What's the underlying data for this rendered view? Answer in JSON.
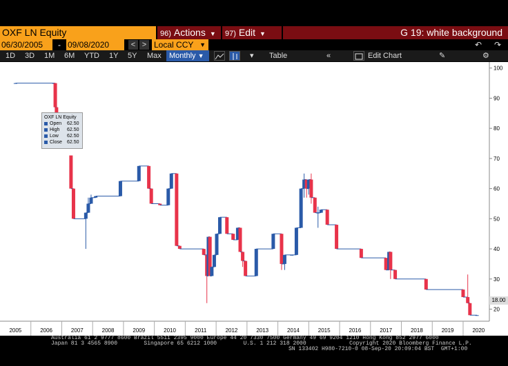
{
  "header": {
    "ticker": "OXF LN Equity",
    "actions_num": "96)",
    "actions_label": "Actions",
    "edit_num": "97)",
    "edit_label": "Edit",
    "graph_title": "G 19: white background"
  },
  "date_bar": {
    "start_date": "06/30/2005",
    "end_date": "09/08/2020",
    "currency": "Local CCY"
  },
  "toolbar": {
    "periods": [
      "1D",
      "3D",
      "1M",
      "6M",
      "YTD",
      "1Y",
      "5Y",
      "Max"
    ],
    "frequency": "Monthly",
    "table_label": "Table",
    "edit_chart_label": "Edit Chart"
  },
  "tooltip": {
    "title": "OXF LN Equity",
    "rows": [
      {
        "label": "Open",
        "value": "62.50"
      },
      {
        "label": "High",
        "value": "62.50"
      },
      {
        "label": "Low",
        "value": "62.50"
      },
      {
        "label": "Close",
        "value": "62.50"
      }
    ]
  },
  "last_price_badge": "18.00",
  "footer": {
    "line1": "Australia 61 2 9777 8600 Brazil 5511 2395 9000 Europe 44 20 7330 7500 Germany 49 69 9204 1210 Hong Kong 852 2977 6000",
    "line2": "Japan 81 3 4565 8900        Singapore 65 6212 1000        U.S. 1 212 318 2000             Copyright 2020 Bloomberg Finance L.P.",
    "line3": "SN 133402 H980-7210-0 08-Sep-20 20:09:04 BST  GMT+1:00"
  },
  "colors": {
    "up": "#2a5aa8",
    "down": "#e8334a",
    "accent": "#f9a11b",
    "menu": "#7a0d12"
  },
  "chart_data": {
    "type": "candlestick",
    "title": "",
    "xlabel": "",
    "ylabel": "",
    "ylim": [
      16,
      102
    ],
    "xlim": [
      2005.0,
      2020.85
    ],
    "yticks": [
      20,
      30,
      40,
      50,
      60,
      70,
      80,
      90,
      100
    ],
    "xticks": [
      "2005",
      "2006",
      "2007",
      "2008",
      "2009",
      "2010",
      "2011",
      "2012",
      "2013",
      "2014",
      "2015",
      "2016",
      "2017",
      "2018",
      "2019",
      "2020"
    ],
    "grid": false,
    "legend": "none",
    "series": [
      {
        "name": "OXF LN Equity",
        "candles": [
          {
            "x": 2005.5,
            "open": 95,
            "high": 95,
            "low": 95,
            "close": 95
          },
          {
            "x": 2006.75,
            "open": 95,
            "high": 95,
            "low": 95,
            "close": 95
          },
          {
            "x": 2006.79,
            "open": 95,
            "high": 95,
            "low": 86,
            "close": 87
          },
          {
            "x": 2006.83,
            "open": 87,
            "high": 87,
            "low": 80,
            "close": 81
          },
          {
            "x": 2007.3,
            "open": 71,
            "high": 71,
            "low": 60,
            "close": 60
          },
          {
            "x": 2007.38,
            "open": 60,
            "high": 60,
            "low": 50,
            "close": 50
          },
          {
            "x": 2007.78,
            "open": 50,
            "high": 52,
            "low": 40,
            "close": 52
          },
          {
            "x": 2007.86,
            "open": 52,
            "high": 57,
            "low": 52,
            "close": 55
          },
          {
            "x": 2007.95,
            "open": 55,
            "high": 58,
            "low": 55,
            "close": 57
          },
          {
            "x": 2008.1,
            "open": 57,
            "high": 57.5,
            "low": 57,
            "close": 57.5
          },
          {
            "x": 2008.9,
            "open": 57.5,
            "high": 62.5,
            "low": 57.5,
            "close": 62.5
          },
          {
            "x": 2009.5,
            "open": 62.5,
            "high": 67.5,
            "low": 62.5,
            "close": 67.5
          },
          {
            "x": 2009.82,
            "open": 67.5,
            "high": 67.5,
            "low": 60,
            "close": 60
          },
          {
            "x": 2009.9,
            "open": 60,
            "high": 60,
            "low": 55,
            "close": 55
          },
          {
            "x": 2010.18,
            "open": 55,
            "high": 55,
            "low": 54.5,
            "close": 54.5
          },
          {
            "x": 2010.45,
            "open": 54.5,
            "high": 60,
            "low": 54.5,
            "close": 60
          },
          {
            "x": 2010.55,
            "open": 60,
            "high": 65,
            "low": 60,
            "close": 65
          },
          {
            "x": 2010.72,
            "open": 65,
            "high": 65,
            "low": 41,
            "close": 41
          },
          {
            "x": 2010.82,
            "open": 41,
            "high": 41,
            "low": 40,
            "close": 40
          },
          {
            "x": 2011.6,
            "open": 40,
            "high": 40,
            "low": 38,
            "close": 38
          },
          {
            "x": 2011.7,
            "open": 38,
            "high": 38,
            "low": 22,
            "close": 31
          },
          {
            "x": 2011.75,
            "open": 31,
            "high": 44,
            "low": 31,
            "close": 44
          },
          {
            "x": 2011.8,
            "open": 44,
            "high": 44,
            "low": 31,
            "close": 31
          },
          {
            "x": 2011.86,
            "open": 31,
            "high": 34,
            "low": 31,
            "close": 34
          },
          {
            "x": 2011.94,
            "open": 34,
            "high": 38,
            "low": 34,
            "close": 38
          },
          {
            "x": 2012.02,
            "open": 38,
            "high": 45,
            "low": 38,
            "close": 45
          },
          {
            "x": 2012.12,
            "open": 45,
            "high": 50.5,
            "low": 45,
            "close": 50.5
          },
          {
            "x": 2012.35,
            "open": 50.5,
            "high": 50.5,
            "low": 45,
            "close": 45
          },
          {
            "x": 2012.55,
            "open": 45,
            "high": 45,
            "low": 43,
            "close": 43
          },
          {
            "x": 2012.7,
            "open": 43,
            "high": 47,
            "low": 43,
            "close": 47
          },
          {
            "x": 2012.78,
            "open": 47,
            "high": 47,
            "low": 39,
            "close": 39
          },
          {
            "x": 2012.86,
            "open": 39,
            "high": 39,
            "low": 34,
            "close": 36
          },
          {
            "x": 2012.95,
            "open": 36,
            "high": 36,
            "low": 31,
            "close": 31
          },
          {
            "x": 2013.3,
            "open": 31,
            "high": 40,
            "low": 31,
            "close": 40
          },
          {
            "x": 2013.85,
            "open": 40,
            "high": 45,
            "low": 40,
            "close": 45
          },
          {
            "x": 2014.12,
            "open": 45,
            "high": 45,
            "low": 33,
            "close": 35
          },
          {
            "x": 2014.22,
            "open": 35,
            "high": 38,
            "low": 33,
            "close": 38
          },
          {
            "x": 2014.45,
            "open": 38,
            "high": 38,
            "low": 38,
            "close": 38
          },
          {
            "x": 2014.6,
            "open": 38,
            "high": 47,
            "low": 38,
            "close": 47
          },
          {
            "x": 2014.75,
            "open": 47,
            "high": 60,
            "low": 47,
            "close": 60
          },
          {
            "x": 2014.85,
            "open": 60,
            "high": 65,
            "low": 57,
            "close": 63
          },
          {
            "x": 2014.93,
            "open": 63,
            "high": 63,
            "low": 57,
            "close": 60
          },
          {
            "x": 2015.0,
            "open": 60,
            "high": 63,
            "low": 58,
            "close": 63
          },
          {
            "x": 2015.08,
            "open": 63,
            "high": 65,
            "low": 55,
            "close": 57
          },
          {
            "x": 2015.2,
            "open": 57,
            "high": 57,
            "low": 52,
            "close": 52
          },
          {
            "x": 2015.3,
            "open": 52,
            "high": 54,
            "low": 47,
            "close": 52
          },
          {
            "x": 2015.4,
            "open": 52,
            "high": 53,
            "low": 52,
            "close": 53
          },
          {
            "x": 2015.6,
            "open": 53,
            "high": 53,
            "low": 48,
            "close": 48
          },
          {
            "x": 2015.9,
            "open": 48,
            "high": 48,
            "low": 40,
            "close": 40
          },
          {
            "x": 2016.7,
            "open": 40,
            "high": 40,
            "low": 37,
            "close": 37
          },
          {
            "x": 2017.5,
            "open": 37,
            "high": 37,
            "low": 33,
            "close": 33
          },
          {
            "x": 2017.6,
            "open": 33,
            "high": 39,
            "low": 33,
            "close": 39
          },
          {
            "x": 2017.65,
            "open": 39,
            "high": 39,
            "low": 30,
            "close": 33
          },
          {
            "x": 2017.8,
            "open": 33,
            "high": 33,
            "low": 30,
            "close": 30
          },
          {
            "x": 2018.8,
            "open": 30,
            "high": 30,
            "low": 26.5,
            "close": 26.5
          },
          {
            "x": 2020.0,
            "open": 26.5,
            "high": 26.5,
            "low": 24,
            "close": 24
          },
          {
            "x": 2020.15,
            "open": 24,
            "high": 31.5,
            "low": 22,
            "close": 22
          },
          {
            "x": 2020.22,
            "open": 22,
            "high": 22,
            "low": 18,
            "close": 18
          },
          {
            "x": 2020.45,
            "open": 18,
            "high": 18,
            "low": 18,
            "close": 18
          }
        ]
      }
    ]
  }
}
